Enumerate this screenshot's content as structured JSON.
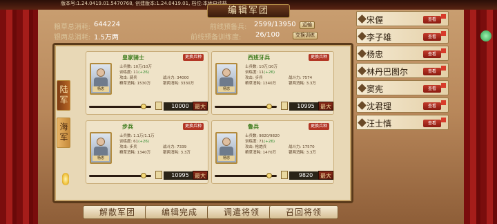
{
  "version_text": "版本号:1.24.0419.01.5470768, 创建版本:1.24.0419.01, 档位:本地自动档",
  "title": "编辑军团",
  "stats": {
    "grain_total_label": "粮草总消耗:",
    "grain_total_value": "644224",
    "silver_total_label": "银两总消耗:",
    "silver_total_value": "1.5万两",
    "front_reserve_label": "前线预备兵:",
    "front_reserve_value": "2599/13950",
    "transport_button": "运输",
    "front_training_label": "前线预备训练度:",
    "front_training_value": "26/100",
    "change_training_button": "交换训练"
  },
  "tabs": {
    "army": "陆军",
    "navy": "海军"
  },
  "cards": [
    {
      "name": "皇家骑士",
      "swap": "更换兵种",
      "portrait_tag": "杨忠",
      "info": [
        [
          "士兵数: 10万/10万",
          ""
        ],
        [
          "训练度: 11(+26)",
          ""
        ],
        [
          "攻击: 骑兵",
          "战斗力: 34000"
        ],
        [
          "粮草消耗: 1530万",
          "银两消耗: 3330万"
        ]
      ],
      "count": "10000",
      "max": "最大",
      "fill": 0.92
    },
    {
      "name": "西班牙兵",
      "swap": "更换兵种",
      "portrait_tag": "杨忠",
      "info": [
        [
          "士兵数: 10万/10万",
          ""
        ],
        [
          "训练度: 11(+26)",
          ""
        ],
        [
          "攻击: 步兵",
          "战斗力: 7574"
        ],
        [
          "粮草消耗: 1340万",
          "银两消耗: 3.3万"
        ]
      ],
      "count": "10995",
      "max": "最大",
      "fill": 0.92
    },
    {
      "name": "步兵",
      "swap": "更换兵种",
      "portrait_tag": "杨忠",
      "info": [
        [
          "士兵数: 1.1万/1.1万",
          ""
        ],
        [
          "训练度: 61(+26)",
          ""
        ],
        [
          "攻击: 步兵",
          "战斗力: 7339"
        ],
        [
          "粮草消耗: 1340万",
          "银两消耗: 3.3万"
        ]
      ],
      "count": "10995",
      "max": "最大",
      "fill": 0.92
    },
    {
      "name": "鲁兵",
      "sub": "枪炮兵",
      "swap": "更换兵种",
      "portrait_tag": "杨忠",
      "info": [
        [
          "士兵数: 9820/9820",
          ""
        ],
        [
          "训练度: 71(+26)",
          ""
        ],
        [
          "攻击: 枪炮兵",
          "战斗力: 17570"
        ],
        [
          "粮草消耗: 1470万",
          "银两消耗: 3.3万"
        ]
      ],
      "count": "9820",
      "max": "最大",
      "fill": 0.92
    }
  ],
  "bottom_buttons": [
    "解散军团",
    "编辑完成",
    "调遣将领",
    "召回将领"
  ],
  "roster": [
    {
      "name": "宋偓",
      "view": "查看"
    },
    {
      "name": "李子雄",
      "view": "查看"
    },
    {
      "name": "杨忠",
      "view": "查看"
    },
    {
      "name": "林丹巴图尔",
      "view": "查看"
    },
    {
      "name": "窦宪",
      "view": "查看"
    },
    {
      "name": "沈君理",
      "view": "查看"
    },
    {
      "name": "汪士慎",
      "view": "查看"
    }
  ]
}
